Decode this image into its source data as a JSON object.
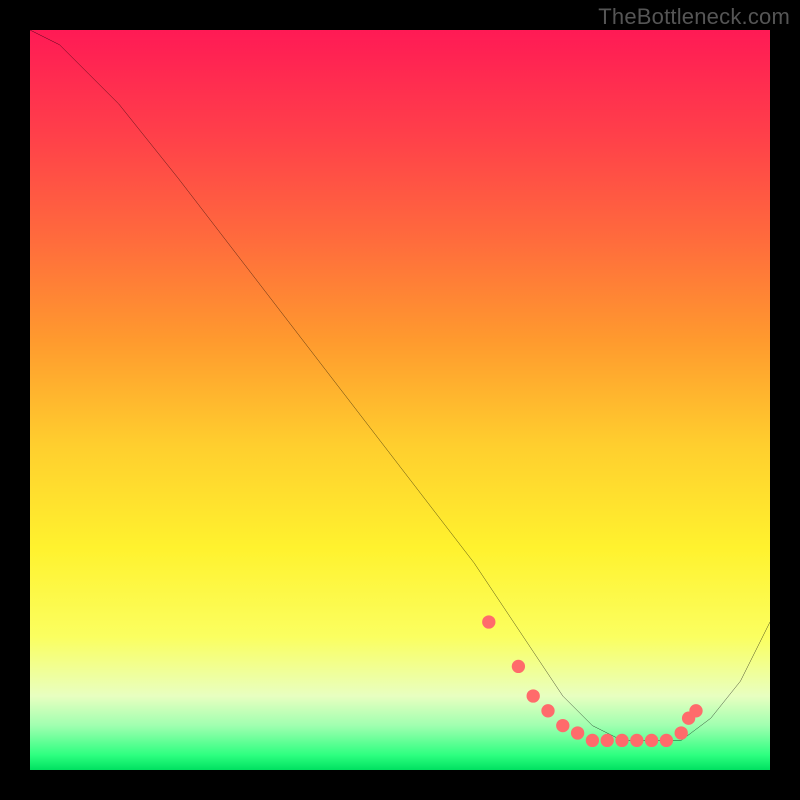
{
  "watermark": "TheBottleneck.com",
  "chart_data": {
    "type": "line",
    "title": "",
    "xlabel": "",
    "ylabel": "",
    "xlim": [
      0,
      100
    ],
    "ylim": [
      0,
      100
    ],
    "series": [
      {
        "name": "curve",
        "x": [
          0,
          4,
          8,
          12,
          20,
          30,
          40,
          50,
          60,
          64,
          68,
          72,
          76,
          80,
          84,
          88,
          92,
          96,
          100
        ],
        "y": [
          100,
          98,
          94,
          90,
          80,
          67,
          54,
          41,
          28,
          22,
          16,
          10,
          6,
          4,
          4,
          4,
          7,
          12,
          20
        ]
      }
    ],
    "markers": {
      "name": "highlight-dots",
      "color": "#ff6b6b",
      "x": [
        62,
        66,
        68,
        70,
        72,
        74,
        76,
        78,
        80,
        82,
        84,
        86,
        88,
        89,
        90
      ],
      "y": [
        20,
        14,
        10,
        8,
        6,
        5,
        4,
        4,
        4,
        4,
        4,
        4,
        5,
        7,
        8
      ]
    },
    "gradient_stops": [
      {
        "pos": 0,
        "color": "#ff1a55"
      },
      {
        "pos": 14,
        "color": "#ff3f4a"
      },
      {
        "pos": 28,
        "color": "#ff6a3d"
      },
      {
        "pos": 42,
        "color": "#ff9a2e"
      },
      {
        "pos": 56,
        "color": "#ffce2e"
      },
      {
        "pos": 70,
        "color": "#fff22e"
      },
      {
        "pos": 82,
        "color": "#fbff60"
      },
      {
        "pos": 90,
        "color": "#e8ffc0"
      },
      {
        "pos": 94,
        "color": "#a0ffb0"
      },
      {
        "pos": 98,
        "color": "#2dff80"
      },
      {
        "pos": 100,
        "color": "#00e060"
      }
    ]
  }
}
